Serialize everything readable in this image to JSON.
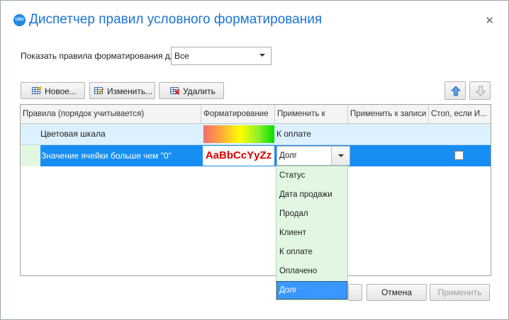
{
  "window": {
    "title": "Диспетчер правил условного форматирования",
    "app_icon_text": "USU"
  },
  "show_rules": {
    "label": "Показать правила форматирования для:",
    "value": "Все"
  },
  "toolbar": {
    "new_label": "Новое...",
    "edit_label": "Изменить...",
    "delete_label": "Удалить"
  },
  "grid": {
    "columns": [
      "Правила (порядок учитывается)",
      "Форматирование",
      "Применить к",
      "Применить к записи",
      "Стоп, если И..."
    ],
    "rows": [
      {
        "rule": "Цветовая шкала",
        "apply_to": "К оплате",
        "selected": false
      },
      {
        "rule": "Значение ячейки больше чем \"0\"",
        "format_sample": "AaBbCcYyZz",
        "apply_to": "Долг",
        "stop_if_true": false,
        "selected": true
      }
    ]
  },
  "dropdown": {
    "options": [
      "Статус",
      "Дата продажи",
      "Продал",
      "Клиент",
      "К оплате",
      "Оплачено",
      "Долг"
    ],
    "selected": "Долг"
  },
  "footer": {
    "cancel_label": "Отмена",
    "apply_label": "Применить"
  },
  "colors": {
    "title": "#1b74d6",
    "selection": "#168ef3",
    "dropdown_bg": "#e2f7e2",
    "format_red": "#d90000"
  }
}
